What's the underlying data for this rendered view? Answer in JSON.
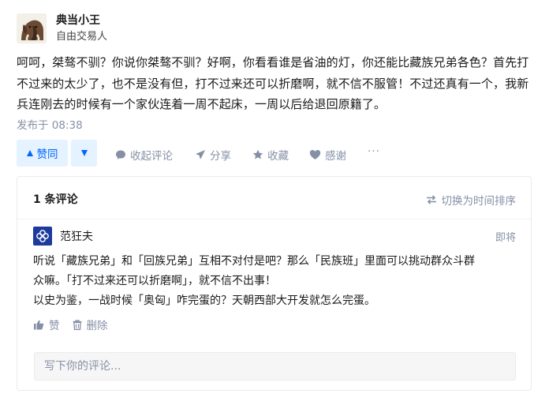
{
  "author": {
    "name": "典当小王",
    "bio": "自由交易人",
    "avatar_icon": "mammoth-avatar"
  },
  "content": {
    "paragraph": "呵呵，桀骜不驯？你说你桀骜不驯？好啊，你看看谁是省油的灯，你还能比藏族兄弟各色？首先打不过来的太少了，也不是没有但，打不过来还可以折磨啊，就不信不服管！不过还真有一个，我新兵连刚去的时候有一个家伙连着一周不起床，一周以后给退回原籍了。"
  },
  "meta": {
    "published": "发布于 08:38"
  },
  "actions": {
    "upvote_label": "赞同",
    "collapse_comments_label": "收起评论",
    "share_label": "分享",
    "favorite_label": "收藏",
    "thanks_label": "感谢",
    "more_label": "···"
  },
  "comments": {
    "count_label": "1 条评论",
    "sort_label": "切换为时间排序",
    "items": [
      {
        "author": "范狂夫",
        "time": "即将",
        "lines": [
          "听说「藏族兄弟」和「回族兄弟」互相不对付是吧？那么「民族班」里面可以挑动群众斗群",
          "众嘛。「打不过来还可以折磨啊」，就不信不出事！",
          "以史为鉴，一战时候「奥匈」咋完蛋的？天朝西部大开发就怎么完蛋。"
        ],
        "like_label": "赞",
        "delete_label": "删除"
      }
    ],
    "input_placeholder": "写下你的评论..."
  },
  "colors": {
    "accent": "#0066ff",
    "accent_bg": "#e5f2ff",
    "muted": "#8590a6"
  }
}
